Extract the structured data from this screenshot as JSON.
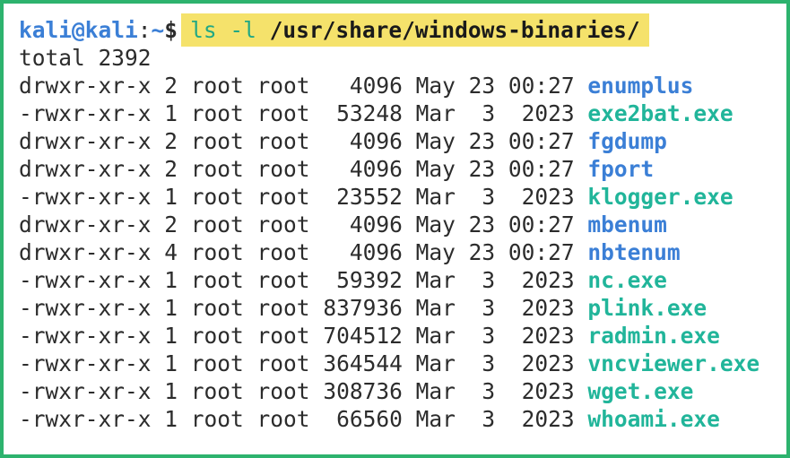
{
  "prompt": {
    "user_host": "kali@kali",
    "separator": ":",
    "path": "~",
    "dollar": "$",
    "command": "ls",
    "flag": "-l",
    "argument": "/usr/share/windows-binaries/"
  },
  "total": "total 2392",
  "listing": [
    {
      "perms": "drwxr-xr-x",
      "links": "2",
      "owner": "root",
      "group": "root",
      "size": "4096",
      "month": "May",
      "day": "23",
      "time": "00:27",
      "name": "enumplus",
      "kind": "dir"
    },
    {
      "perms": "-rwxr-xr-x",
      "links": "1",
      "owner": "root",
      "group": "root",
      "size": "53248",
      "month": "Mar",
      "day": "3",
      "time": "2023",
      "name": "exe2bat.exe",
      "kind": "exe"
    },
    {
      "perms": "drwxr-xr-x",
      "links": "2",
      "owner": "root",
      "group": "root",
      "size": "4096",
      "month": "May",
      "day": "23",
      "time": "00:27",
      "name": "fgdump",
      "kind": "dir"
    },
    {
      "perms": "drwxr-xr-x",
      "links": "2",
      "owner": "root",
      "group": "root",
      "size": "4096",
      "month": "May",
      "day": "23",
      "time": "00:27",
      "name": "fport",
      "kind": "dir"
    },
    {
      "perms": "-rwxr-xr-x",
      "links": "1",
      "owner": "root",
      "group": "root",
      "size": "23552",
      "month": "Mar",
      "day": "3",
      "time": "2023",
      "name": "klogger.exe",
      "kind": "exe"
    },
    {
      "perms": "drwxr-xr-x",
      "links": "2",
      "owner": "root",
      "group": "root",
      "size": "4096",
      "month": "May",
      "day": "23",
      "time": "00:27",
      "name": "mbenum",
      "kind": "dir"
    },
    {
      "perms": "drwxr-xr-x",
      "links": "4",
      "owner": "root",
      "group": "root",
      "size": "4096",
      "month": "May",
      "day": "23",
      "time": "00:27",
      "name": "nbtenum",
      "kind": "dir"
    },
    {
      "perms": "-rwxr-xr-x",
      "links": "1",
      "owner": "root",
      "group": "root",
      "size": "59392",
      "month": "Mar",
      "day": "3",
      "time": "2023",
      "name": "nc.exe",
      "kind": "exe"
    },
    {
      "perms": "-rwxr-xr-x",
      "links": "1",
      "owner": "root",
      "group": "root",
      "size": "837936",
      "month": "Mar",
      "day": "3",
      "time": "2023",
      "name": "plink.exe",
      "kind": "exe"
    },
    {
      "perms": "-rwxr-xr-x",
      "links": "1",
      "owner": "root",
      "group": "root",
      "size": "704512",
      "month": "Mar",
      "day": "3",
      "time": "2023",
      "name": "radmin.exe",
      "kind": "exe"
    },
    {
      "perms": "-rwxr-xr-x",
      "links": "1",
      "owner": "root",
      "group": "root",
      "size": "364544",
      "month": "Mar",
      "day": "3",
      "time": "2023",
      "name": "vncviewer.exe",
      "kind": "exe"
    },
    {
      "perms": "-rwxr-xr-x",
      "links": "1",
      "owner": "root",
      "group": "root",
      "size": "308736",
      "month": "Mar",
      "day": "3",
      "time": "2023",
      "name": "wget.exe",
      "kind": "exe"
    },
    {
      "perms": "-rwxr-xr-x",
      "links": "1",
      "owner": "root",
      "group": "root",
      "size": "66560",
      "month": "Mar",
      "day": "3",
      "time": "2023",
      "name": "whoami.exe",
      "kind": "exe"
    }
  ],
  "colors": {
    "border": "#2db36e",
    "highlight": "#f5e26b",
    "directory": "#3b7fd6",
    "executable": "#21b59a",
    "text": "#2c2c2c"
  }
}
